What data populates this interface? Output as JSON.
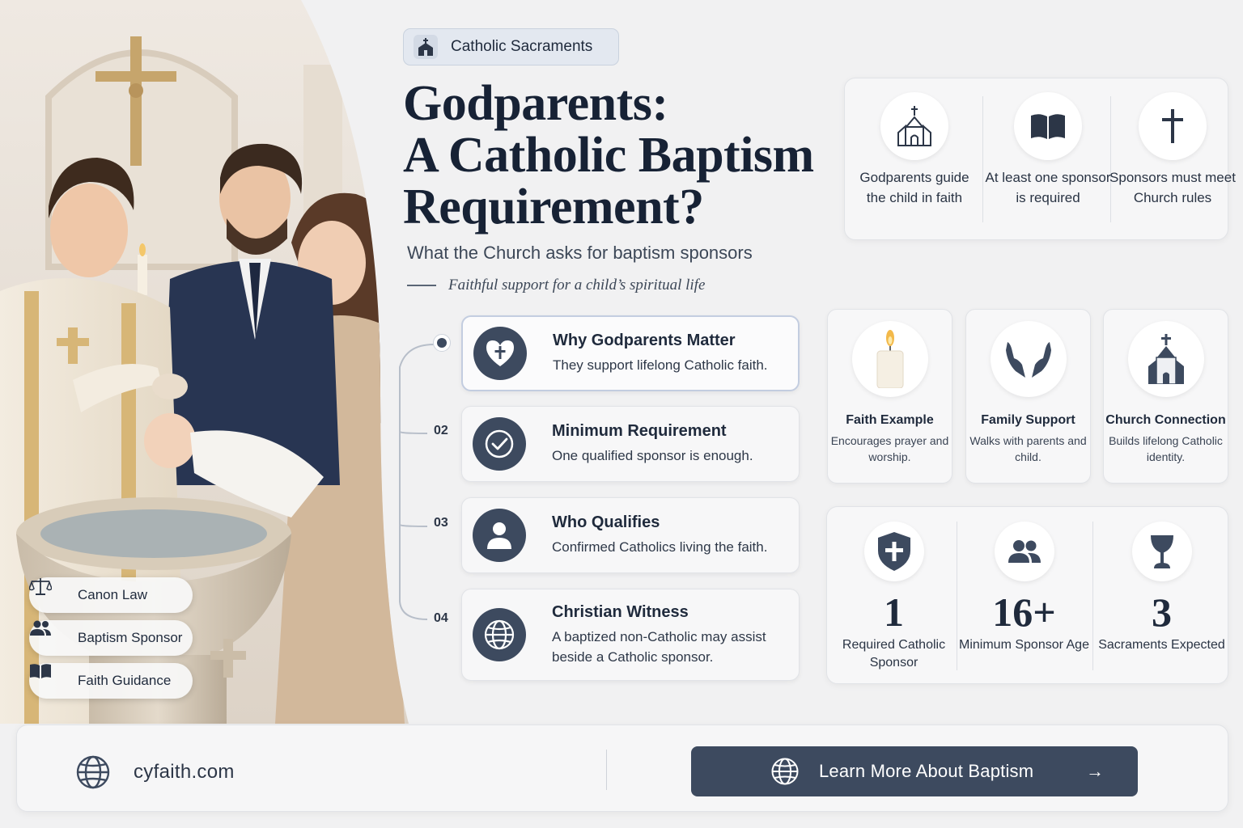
{
  "badge": {
    "label": "Catholic Sacraments",
    "icon": "church-icon"
  },
  "title": {
    "line1": "Godparents:",
    "line2": "A Catholic Baptism",
    "line3": "Requirement?"
  },
  "subtitle": "What the Church asks for baptism sponsors",
  "tagline": "Faithful support for a child’s spiritual life",
  "photo_tags": [
    {
      "label": "Canon Law",
      "icon": "scales-icon"
    },
    {
      "label": "Baptism Sponsor",
      "icon": "people-icon"
    },
    {
      "label": "Faith Guidance",
      "icon": "book-icon"
    }
  ],
  "steps": [
    {
      "num": "",
      "title": "Why Godparents Matter",
      "text": "They support lifelong Catholic faith.",
      "icon": "heart-cross-icon"
    },
    {
      "num": "02",
      "title": "Minimum Requirement",
      "text": "One qualified sponsor is enough.",
      "icon": "checkmark-icon"
    },
    {
      "num": "03",
      "title": "Who Qualifies",
      "text": "Confirmed Catholics living the faith.",
      "icon": "person-icon"
    },
    {
      "num": "04",
      "title": "Christian Witness",
      "text": "A baptized non-Catholic may assist beside a Catholic sponsor.",
      "icon": "globe-icon"
    }
  ],
  "info": [
    {
      "text": "Godparents guide the child in faith",
      "icon": "church-icon"
    },
    {
      "text": "At least one sponsor is required",
      "icon": "book-icon"
    },
    {
      "text": "Sponsors must meet Church rules",
      "icon": "cross-icon"
    }
  ],
  "features": [
    {
      "title": "Faith Example",
      "text": "Encourages prayer and worship.",
      "icon": "candle-icon"
    },
    {
      "title": "Family Support",
      "text": "Walks with parents and child.",
      "icon": "praying-hands-icon"
    },
    {
      "title": "Church Connection",
      "text": "Builds lifelong Catholic identity.",
      "icon": "church-icon"
    }
  ],
  "stats": [
    {
      "value": "1",
      "label": "Required Catholic Sponsor",
      "icon": "shield-cross-icon"
    },
    {
      "value": "16+",
      "label": "Minimum Sponsor Age",
      "icon": "people-icon"
    },
    {
      "value": "3",
      "label": "Sacraments Expected",
      "icon": "chalice-icon"
    }
  ],
  "footer": {
    "site": "cyfaith.com",
    "site_icon": "globe-icon",
    "cta": "Learn More About Baptism",
    "cta_icon": "globe-icon",
    "cta_arrow": "→"
  },
  "colors": {
    "accent": "#3d4a5f",
    "background": "#f1f1f2",
    "title": "#172235"
  }
}
